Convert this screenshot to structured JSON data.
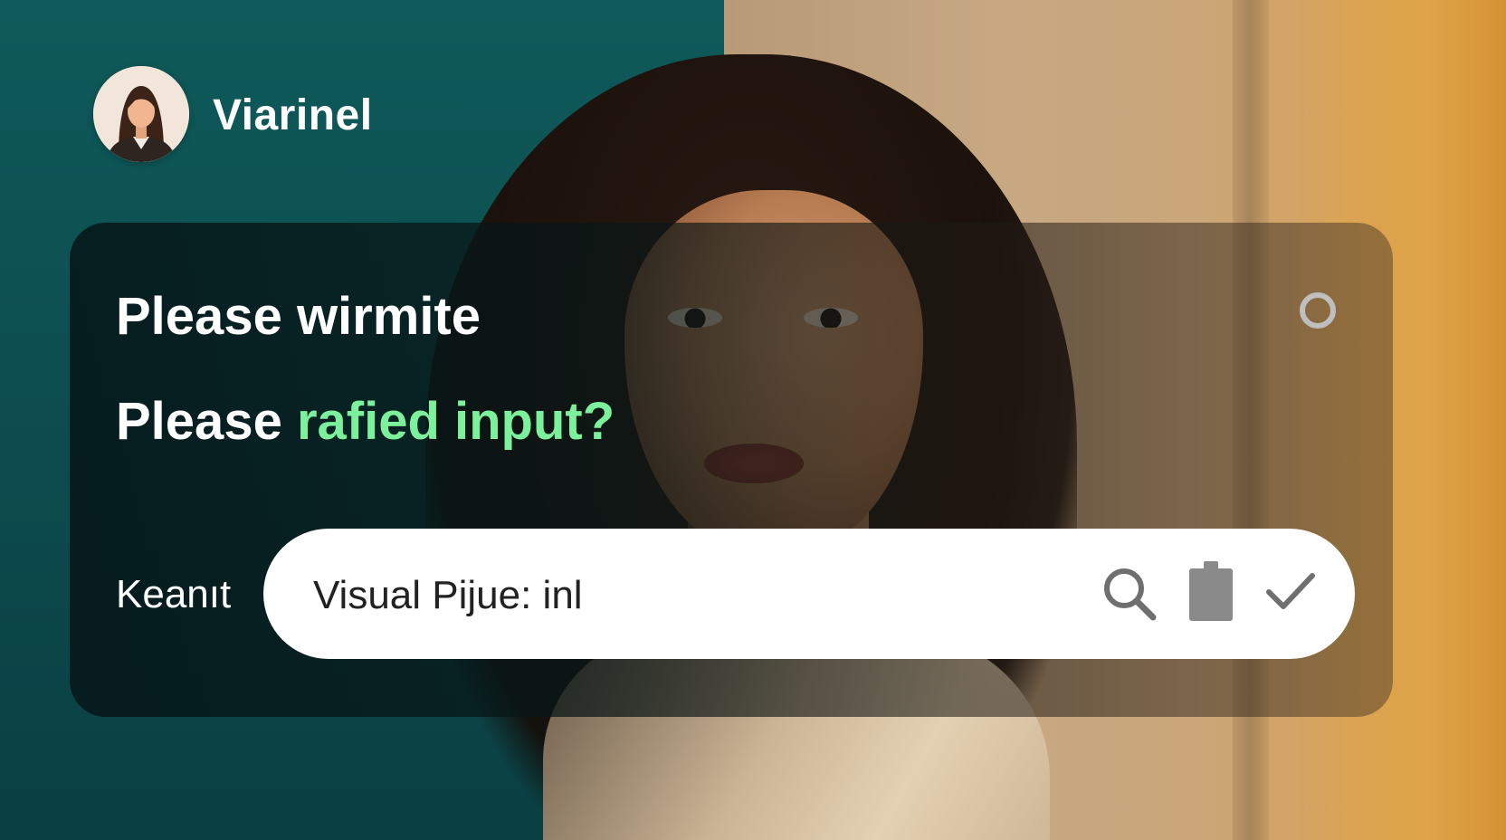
{
  "header": {
    "app_name": "Viarinel",
    "avatar_icon": "user-avatar-icon"
  },
  "dialog": {
    "line_1": "Please wirmite",
    "line_2_prefix": "Please ",
    "line_2_highlight": "rafied input?",
    "accent_color": "#7cf09a",
    "status_icon": "circle-icon"
  },
  "input_row": {
    "label": "Keanıt",
    "value": "Visual Pijue: inl",
    "icons": [
      "search-icon",
      "clipboard-icon",
      "check-icon"
    ]
  }
}
